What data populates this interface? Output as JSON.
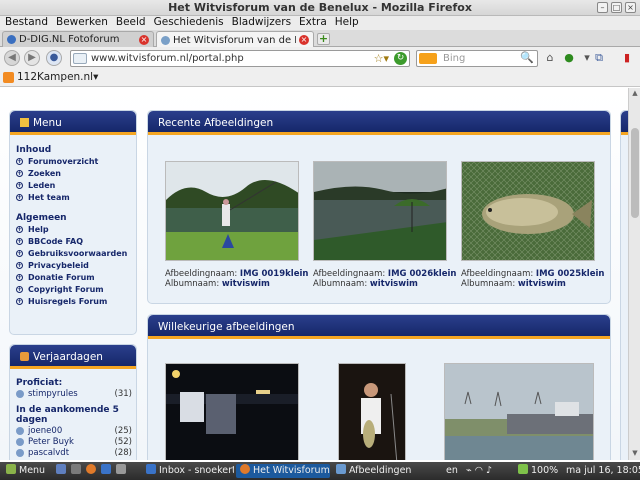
{
  "window": {
    "title": "Het Witvisforum van de Benelux - Mozilla Firefox"
  },
  "menu": [
    "Bestand",
    "Bewerken",
    "Beeld",
    "Geschiedenis",
    "Bladwijzers",
    "Extra",
    "Help"
  ],
  "tabs": [
    {
      "label": "D-DIG.NL Fotoforum"
    },
    {
      "label": "Het Witvisforum van de Ben..."
    }
  ],
  "nav": {
    "url": "www.witvisforum.nl/portal.php",
    "search_placeholder": "Bing"
  },
  "bookmarks": {
    "item": "112Kampen.nl"
  },
  "menu_panel": {
    "title": "Menu",
    "inhoud_title": "Inhoud",
    "inhoud": [
      "Forumoverzicht",
      "Zoeken",
      "Leden",
      "Het team"
    ],
    "algemeen_title": "Algemeen",
    "algemeen": [
      "Help",
      "BBCode FAQ",
      "Gebruiksvoorwaarden",
      "Privacybeleid",
      "Donatie Forum",
      "Copyright Forum",
      "Huisregels Forum"
    ]
  },
  "birthday_panel": {
    "title": "Verjaardagen",
    "today_label": "Proficiat:",
    "today": [
      {
        "name": "stimpyrules",
        "age": "(31)"
      }
    ],
    "upcoming_label": "In de aankomende 5 dagen",
    "upcoming": [
      {
        "name": "joene00",
        "age": "(25)"
      },
      {
        "name": "Peter Buyk",
        "age": "(52)"
      },
      {
        "name": "pascalvdt",
        "age": "(28)"
      }
    ]
  },
  "recent": {
    "title": "Recente Afbeeldingen",
    "label_image": "Afbeeldingnaam:",
    "label_album": "Albumnaam:",
    "items": [
      {
        "image": "IMG 0019klein",
        "album": "witviswim"
      },
      {
        "image": "IMG 0026klein",
        "album": "witviswim"
      },
      {
        "image": "IMG 0025klein",
        "album": "witviswim"
      }
    ]
  },
  "random": {
    "title": "Willekeurige afbeeldingen"
  },
  "taskbar": {
    "menu": "Menu",
    "items": [
      "Inbox - snoekert@x...",
      "Het Witvisforum van...",
      "Afbeeldingen"
    ],
    "tray_lang": "en",
    "battery": "100%",
    "clock": "ma jul 16, 18:05"
  }
}
